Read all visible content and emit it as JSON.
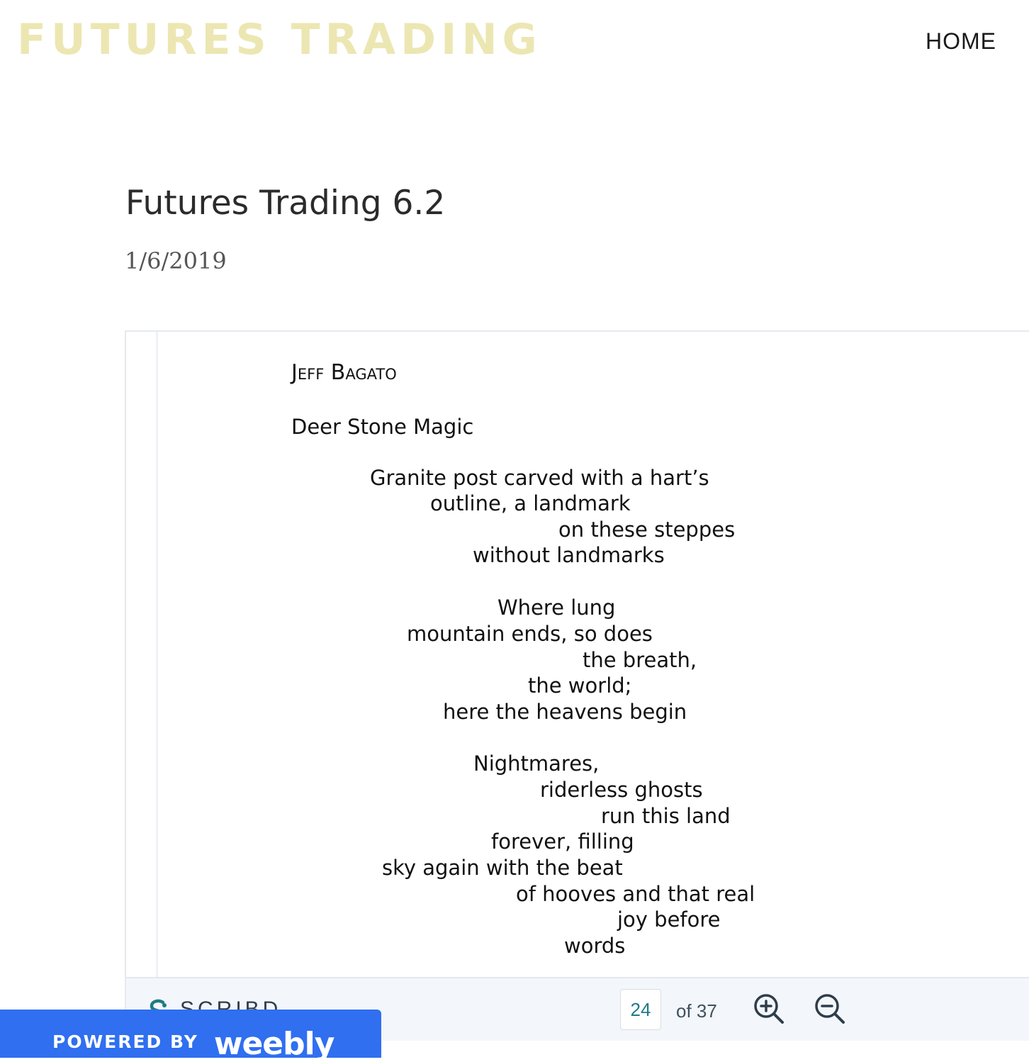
{
  "header": {
    "site_title": "FUTURES TRADING",
    "nav": [
      {
        "label": "HOME"
      }
    ]
  },
  "post": {
    "title": "Futures Trading 6.2",
    "date": "1/6/2019"
  },
  "document": {
    "author": "Jeff Bagato",
    "poem_title": "Deer Stone Magic",
    "lines": [
      "Granite post carved with a hart’s",
      "outline, a landmark",
      "on these steppes",
      "without landmarks",
      "Where lung",
      "mountain ends, so does",
      "the breath,",
      "the world;",
      "here the heavens begin",
      "Nightmares,",
      "riderless ghosts",
      "run this land",
      "forever, filling",
      "sky again with the beat",
      "of hooves and that real",
      "joy before",
      "words"
    ]
  },
  "viewer": {
    "brand": "SCRIBD",
    "current_page": "24",
    "total_pages_label": "of 37",
    "accent_color": "#1e7b85",
    "zoom_in_icon": "zoom-in-icon",
    "zoom_out_icon": "zoom-out-icon"
  },
  "footer": {
    "powered_by": "POWERED BY",
    "brand": "weebly",
    "badge_color": "#2f6ff0"
  },
  "colors": {
    "site_title": "#ece7b2",
    "text": "#111111"
  }
}
